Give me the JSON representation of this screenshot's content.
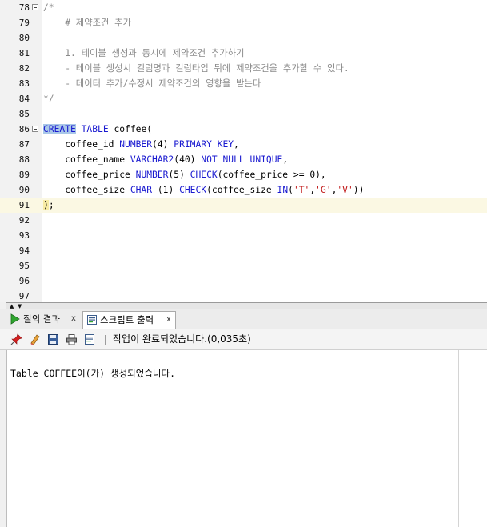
{
  "editor": {
    "lines": [
      {
        "num": "78",
        "fold": true,
        "text": "/*"
      },
      {
        "num": "79",
        "fold": false,
        "text": "    # 제약조건 추가"
      },
      {
        "num": "80",
        "fold": false,
        "text": ""
      },
      {
        "num": "81",
        "fold": false,
        "text": "    1. 테이블 생성과 동시에 제약조건 추가하기"
      },
      {
        "num": "82",
        "fold": false,
        "text": "    - 테이블 생성시 컬럼명과 컬럼타입 뒤에 제약조건을 추가할 수 있다."
      },
      {
        "num": "83",
        "fold": false,
        "text": "    - 데이터 추가/수정시 제약조건의 영향을 받는다"
      },
      {
        "num": "84",
        "fold": false,
        "text": "*/"
      },
      {
        "num": "85",
        "fold": false,
        "text": ""
      },
      {
        "num": "86",
        "fold": true,
        "text": "CREATE TABLE coffee("
      },
      {
        "num": "87",
        "fold": false,
        "text": "    coffee_id NUMBER(4) PRIMARY KEY,"
      },
      {
        "num": "88",
        "fold": false,
        "text": "    coffee_name VARCHAR2(40) NOT NULL UNIQUE,"
      },
      {
        "num": "89",
        "fold": false,
        "text": "    coffee_price NUMBER(5) CHECK(coffee_price >= 0),"
      },
      {
        "num": "90",
        "fold": false,
        "text": "    coffee_size CHAR (1) CHECK(coffee_size IN('T','G','V'))"
      },
      {
        "num": "91",
        "fold": false,
        "text": ");"
      },
      {
        "num": "92",
        "fold": false,
        "text": ""
      },
      {
        "num": "93",
        "fold": false,
        "text": ""
      },
      {
        "num": "94",
        "fold": false,
        "text": ""
      },
      {
        "num": "95",
        "fold": false,
        "text": ""
      },
      {
        "num": "96",
        "fold": false,
        "text": ""
      },
      {
        "num": "97",
        "fold": false,
        "text": ""
      }
    ],
    "current_line": "91"
  },
  "tabs": [
    {
      "label": "질의 결과",
      "close": "x",
      "icon": "run-query-icon",
      "active": false
    },
    {
      "label": "스크립트 출력",
      "close": "x",
      "icon": "script-output-icon",
      "active": true
    }
  ],
  "toolbar": {
    "buttons": [
      "pin-icon",
      "eraser-icon",
      "save-icon",
      "print-icon",
      "export-icon"
    ],
    "status": "작업이 완료되었습니다.(0,035초)"
  },
  "output": {
    "text": "Table COFFEE이(가) 생성되었습니다."
  },
  "colors": {
    "keyword": "#1a1ad0",
    "comment": "#8a8a8a",
    "string": "#c01818",
    "current_line_bg": "#fbf8e3",
    "selection_bg": "#a9c7e8"
  }
}
